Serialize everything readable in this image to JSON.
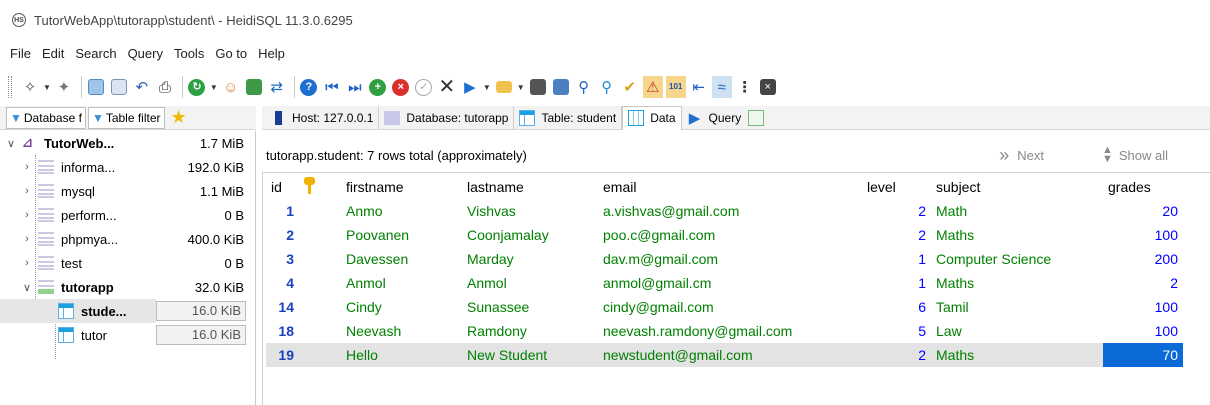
{
  "window": {
    "title": "TutorWebApp\\tutorapp\\student\\ - HeidiSQL 11.3.0.6295",
    "app_icon_text": "HS"
  },
  "menu": [
    "File",
    "Edit",
    "Search",
    "Query",
    "Tools",
    "Go to",
    "Help"
  ],
  "left_tabs": [
    {
      "label": "Database f",
      "icon": "database-filter-icon"
    },
    {
      "label": "Table filter",
      "icon": "table-filter-icon"
    }
  ],
  "right_tabs": [
    {
      "label": "Host: 127.0.0.1",
      "icon": "host-icon",
      "active": false
    },
    {
      "label": "Database: tutorapp",
      "icon": "database-icon",
      "active": false
    },
    {
      "label": "Table: student",
      "icon": "table-icon",
      "active": false
    },
    {
      "label": "Data",
      "icon": "data-grid-icon",
      "active": true
    },
    {
      "label": "Query",
      "icon": "query-play-icon",
      "active": false
    }
  ],
  "tree": {
    "root": {
      "name": "TutorWeb...",
      "size": "1.7 MiB"
    },
    "databases": [
      {
        "name": "informa...",
        "size": "192.0 KiB"
      },
      {
        "name": "mysql",
        "size": "1.1 MiB"
      },
      {
        "name": "perform...",
        "size": "0 B"
      },
      {
        "name": "phpmya...",
        "size": "400.0 KiB"
      },
      {
        "name": "test",
        "size": "0 B"
      },
      {
        "name": "tutorapp",
        "size": "32.0 KiB"
      }
    ],
    "tables": [
      {
        "name": "stude...",
        "size": "16.0 KiB",
        "selected": true
      },
      {
        "name": "tutor",
        "size": "16.0 KiB",
        "selected": false
      }
    ]
  },
  "grid": {
    "info": "tutorapp.student: 7 rows total (approximately)",
    "next_label": "Next",
    "show_all_label": "Show all",
    "columns": [
      "id",
      "",
      "firstname",
      "lastname",
      "email",
      "level",
      "subject",
      "grades"
    ],
    "rows": [
      [
        "1",
        "Anmo",
        "Vishvas",
        "a.vishvas@gmail.com",
        "2",
        "Math",
        "20"
      ],
      [
        "2",
        "Poovanen",
        "Coonjamalay",
        "poo.c@gmail.com",
        "2",
        "Maths",
        "100"
      ],
      [
        "3",
        "Davessen",
        "Marday",
        "dav.m@gmail.com",
        "1",
        "Computer Science",
        "200"
      ],
      [
        "4",
        "Anmol",
        "Anmol",
        "anmol@gmail.cm",
        "1",
        "Maths",
        "2"
      ],
      [
        "14",
        "Cindy",
        "Sunassee",
        "cindy@gmail.com",
        "6",
        "Tamil",
        "100"
      ],
      [
        "18",
        "Neevash",
        "Ramdony",
        "neevash.ramdony@gmail.com",
        "5",
        "Law",
        "100"
      ],
      [
        "19",
        "Hello",
        "New Student",
        "newstudent@gmail.com",
        "2",
        "Maths",
        "70"
      ]
    ],
    "selected_row": 6,
    "focused_column": "grades"
  },
  "colors": {
    "text_value": "#008000",
    "numeric_value": "#0000ff",
    "id_value": "#1a3fbf",
    "selection_focus": "#0a6bd8",
    "selection_row": "#e3e3e3"
  }
}
